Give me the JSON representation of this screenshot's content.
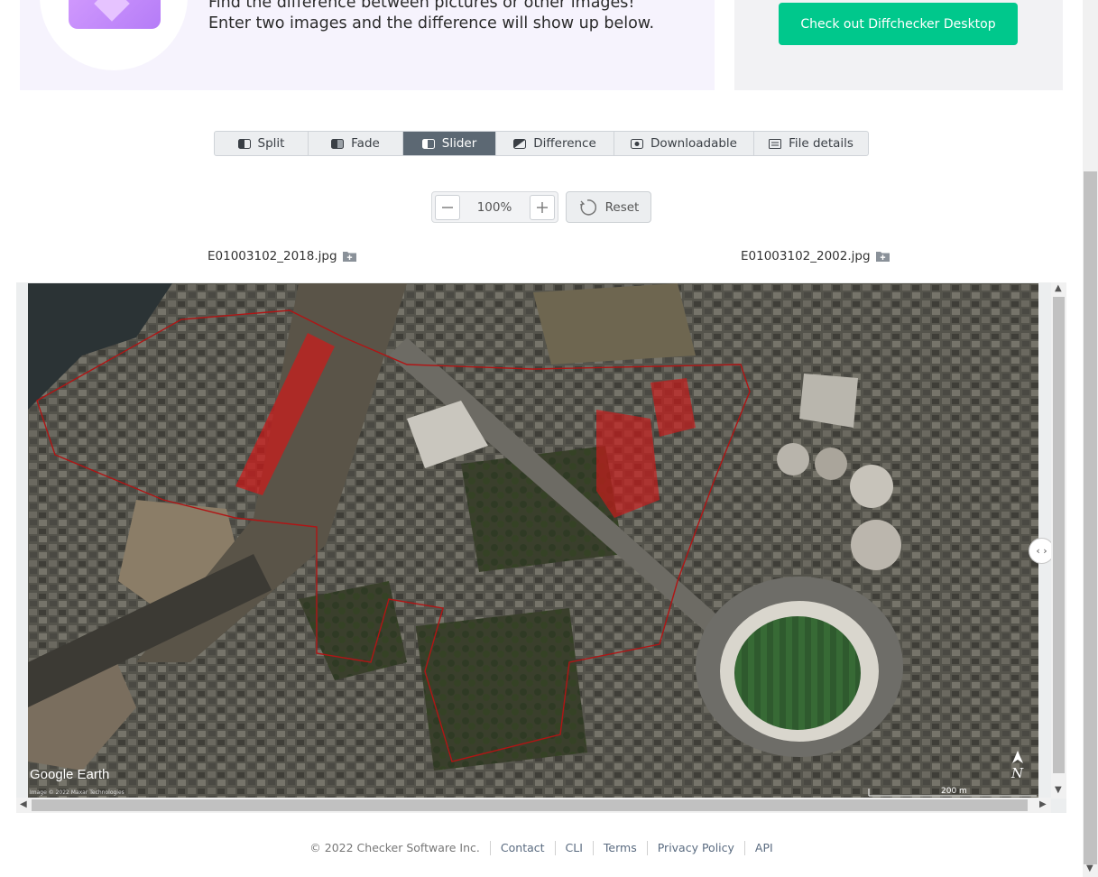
{
  "banner": {
    "line1": "Find the difference between pictures or other images!",
    "line2": "Enter two images and the difference will show up below."
  },
  "desktop_cta": {
    "label": "Check out Diffchecker Desktop",
    "color": "#00c88c"
  },
  "tabs": [
    {
      "label": "Split",
      "icon": "split-icon",
      "active": false
    },
    {
      "label": "Fade",
      "icon": "fade-icon",
      "active": false
    },
    {
      "label": "Slider",
      "icon": "slider-icon",
      "active": true
    },
    {
      "label": "Difference",
      "icon": "difference-icon",
      "active": false
    },
    {
      "label": "Downloadable",
      "icon": "download-icon",
      "active": false
    },
    {
      "label": "File details",
      "icon": "file-details-icon",
      "active": false
    }
  ],
  "zoom": {
    "value": "100%",
    "reset_label": "Reset"
  },
  "files": {
    "left": "E01003102_2018.jpg",
    "right": "E01003102_2002.jpg"
  },
  "map": {
    "watermark": "Google Earth",
    "credit": "Image © 2022 Maxar Technologies",
    "scale": "200 m",
    "north": "N"
  },
  "footer": {
    "copyright": "© 2022 Checker Software Inc.",
    "links": [
      "Contact",
      "CLI",
      "Terms",
      "Privacy Policy",
      "API"
    ]
  },
  "colors": {
    "active_tab": "#5c6873",
    "accent": "#00c88c",
    "highlight": "#d01818"
  }
}
